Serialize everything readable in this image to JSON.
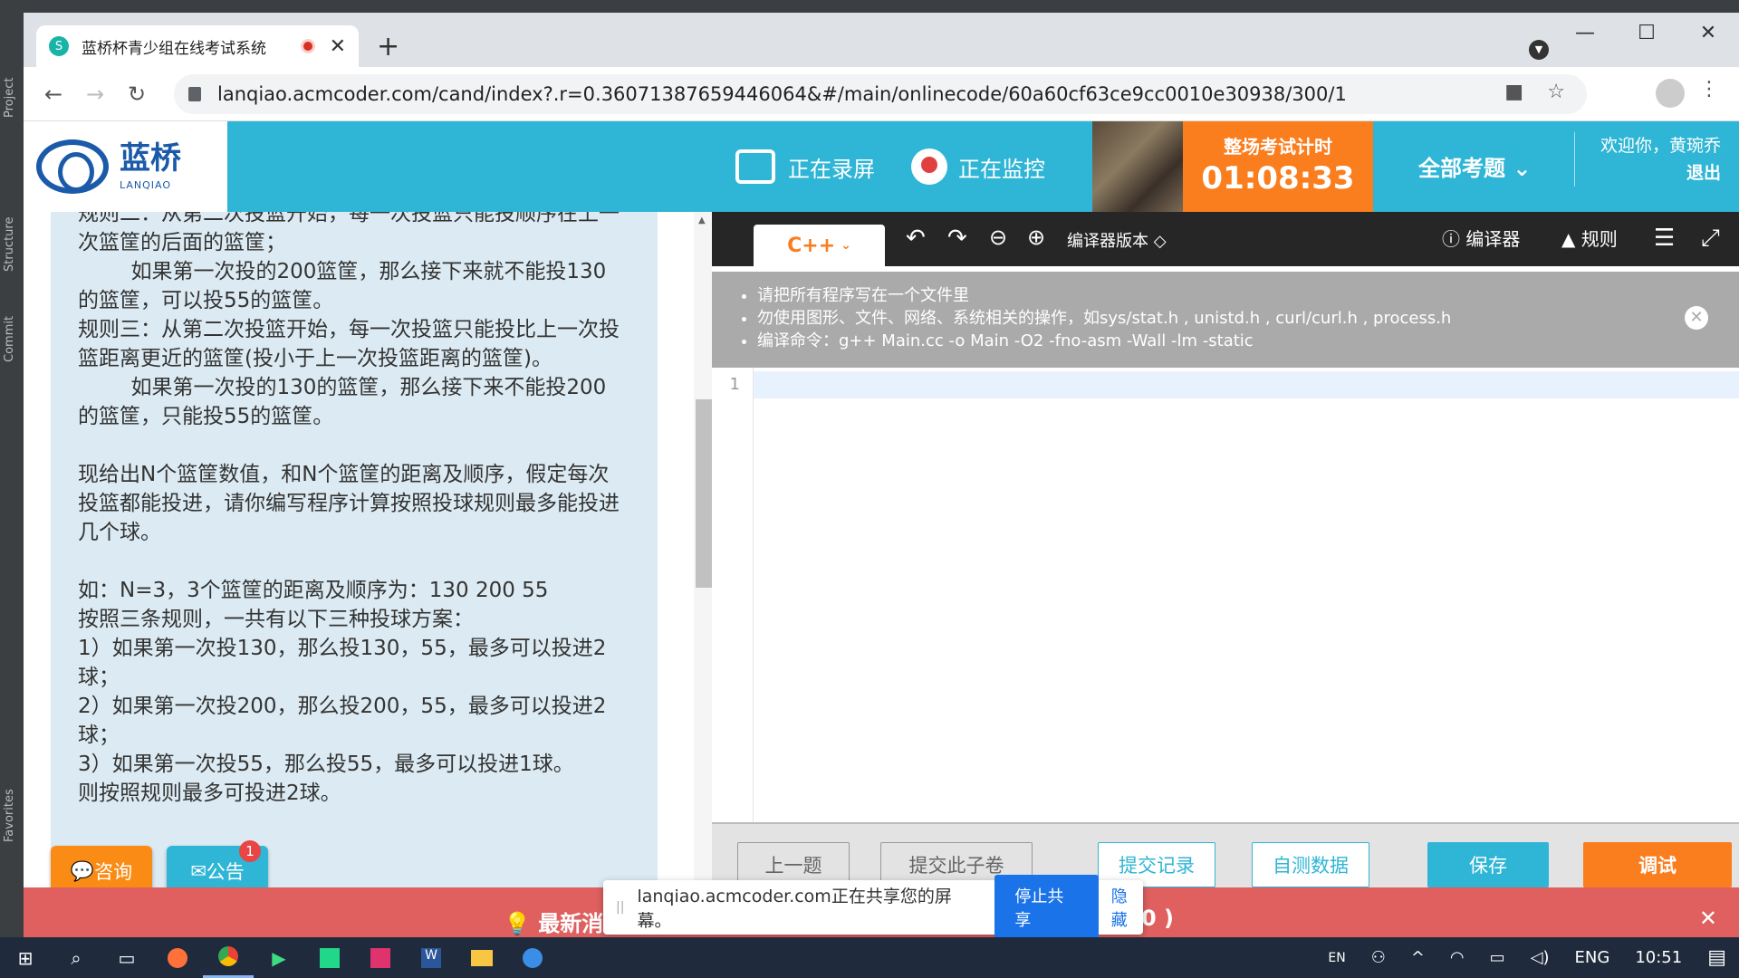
{
  "ide": {
    "side_tabs": [
      "Project",
      "Structure",
      "Commit",
      "Favorites"
    ]
  },
  "browser": {
    "tab_title": "蓝桥杯青少组在线考试系统",
    "tab_close": "✕",
    "new_tab": "+",
    "url": "lanqiao.acmcoder.com/cand/index?.r=0.36071387659446064&#/main/onlinecode/60a60cf63ce9cc0010e30938/300/1"
  },
  "header": {
    "logo_cn": "蓝桥",
    "logo_en": "LANQIAO",
    "recording": "正在录屏",
    "monitoring": "正在监控",
    "timer_label": "整场考试计时",
    "timer_value": "01:08:33",
    "all_questions": "全部考题",
    "welcome": "欢迎你，黄琬乔",
    "logout": "退出"
  },
  "question": {
    "text": "规则二：从第二次投篮开始，每一次投篮只能投顺序在上一次篮筐的后面的篮筐；\n        如果第一次投的200篮筐，那么接下来就不能投130的篮筐，可以投55的篮筐。\n规则三：从第二次投篮开始，每一次投篮只能投比上一次投篮距离更近的篮筐(投小于上一次投篮距离的篮筐)。\n        如果第一次投的130的篮筐，那么接下来不能投200的篮筐，只能投55的篮筐。\n\n现给出N个篮筐数值，和N个篮筐的距离及顺序，假定每次投篮都能投进，请你编写程序计算按照投球规则最多能投进几个球。\n\n如：N=3，3个篮筐的距离及顺序为：130 200 55\n按照三条规则，一共有以下三种投球方案：\n1）如果第一次投130，那么投130，55，最多可以投进2球；\n2）如果第一次投200，那么投200，55，最多可以投进2球；\n3）如果第一次投55，那么投55，最多可以投进1球。\n则按照规则最多可投进2球。"
  },
  "float_buttons": {
    "consult": "咨询",
    "notice": "公告",
    "notice_badge": "1"
  },
  "editor": {
    "language": "C++",
    "compiler_version": "编译器版本",
    "compiler": "编译器",
    "rules": "规则",
    "notices": [
      "请把所有程序写在一个文件里",
      "勿使用图形、文件、网络、系统相关的操作，如sys/stat.h , unistd.h , curl/curl.h , process.h",
      "编译命令：g++ Main.cc -o Main -O2 -fno-asm -Wall -lm -static"
    ],
    "line_number": "1"
  },
  "bottom_buttons": {
    "prev": "上一题",
    "submit_part": "提交此子卷",
    "submit_record": "提交记录",
    "self_test": "自测数据",
    "save": "保存",
    "debug": "调试"
  },
  "announcement": {
    "text": "最新消",
    "tail": "0 )",
    "close": "✕"
  },
  "share_bar": {
    "message": "lanqiao.acmcoder.com正在共享您的屏幕。",
    "stop": "停止共享",
    "hide": "隐藏"
  },
  "taskbar": {
    "lang_short": "EN",
    "lang": "ENG",
    "time": "10:51"
  }
}
